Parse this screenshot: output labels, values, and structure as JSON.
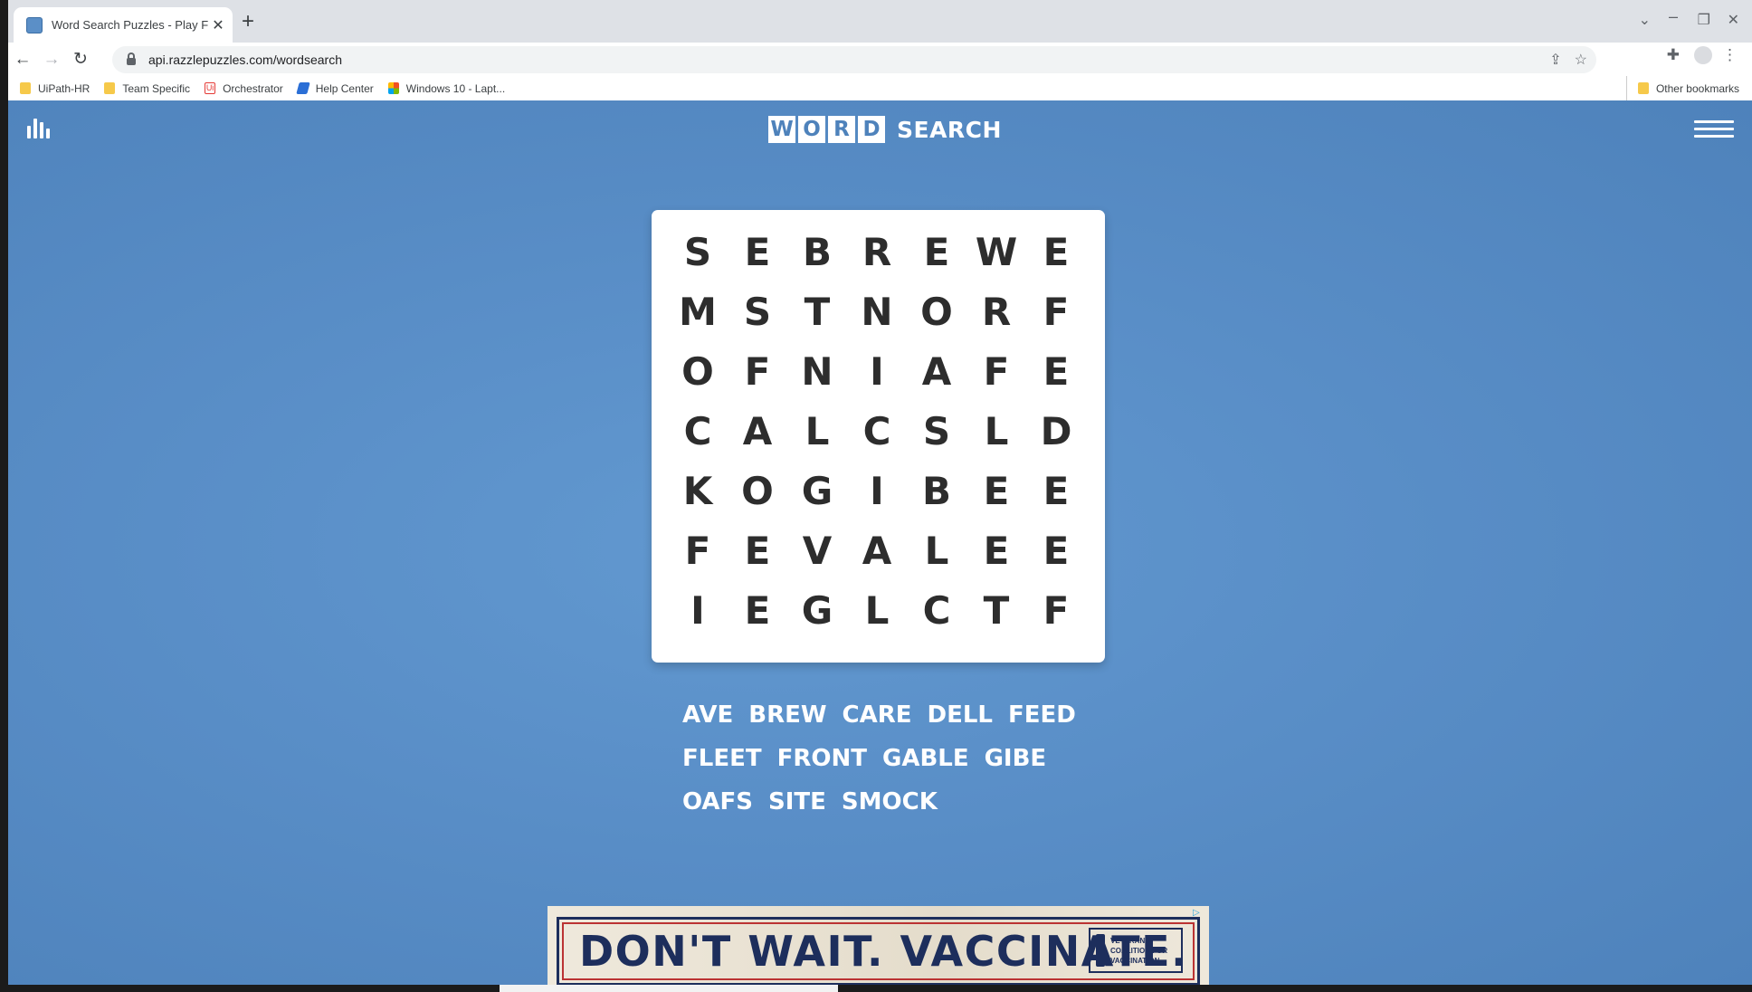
{
  "browser": {
    "tab_title": "Word Search Puzzles - Play Free C",
    "new_tab": "+",
    "url": "api.razzlepuzzles.com/wordsearch",
    "bookmarks": [
      {
        "label": "UiPath-HR",
        "icon": "folder-icon"
      },
      {
        "label": "Team Specific",
        "icon": "folder-icon"
      },
      {
        "label": "Orchestrator",
        "icon": "uipath-icon"
      },
      {
        "label": "Help Center",
        "icon": "jira-icon"
      },
      {
        "label": "Windows 10 - Lapt...",
        "icon": "windows-icon"
      }
    ],
    "other_bookmarks": "Other bookmarks"
  },
  "header": {
    "logo_letters": [
      "W",
      "O",
      "R",
      "D"
    ],
    "logo_word": "SEARCH"
  },
  "grid": [
    [
      "S",
      "E",
      "B",
      "R",
      "E",
      "W",
      "E"
    ],
    [
      "M",
      "S",
      "T",
      "N",
      "O",
      "R",
      "F"
    ],
    [
      "O",
      "F",
      "N",
      "I",
      "A",
      "F",
      "E"
    ],
    [
      "C",
      "A",
      "L",
      "C",
      "S",
      "L",
      "D"
    ],
    [
      "K",
      "O",
      "G",
      "I",
      "B",
      "E",
      "E"
    ],
    [
      "F",
      "E",
      "V",
      "A",
      "L",
      "E",
      "E"
    ],
    [
      "I",
      "E",
      "G",
      "L",
      "C",
      "T",
      "F"
    ]
  ],
  "words": [
    "AVE",
    "BREW",
    "CARE",
    "DELL",
    "FEED",
    "FLEET",
    "FRONT",
    "GABLE",
    "GIBE",
    "OAFS",
    "SITE",
    "SMOCK"
  ],
  "ad": {
    "headline": "DON'T WAIT. VACCINATE.",
    "brand_lines": [
      "VETERANS",
      "COALITION FOR",
      "VACCINATION"
    ]
  },
  "colors": {
    "page_background": "#5a8fc8",
    "logo_box_text": "#4e82bb",
    "grid_letter": "#2d2d2d",
    "ad_navy": "#1d2e5c"
  }
}
